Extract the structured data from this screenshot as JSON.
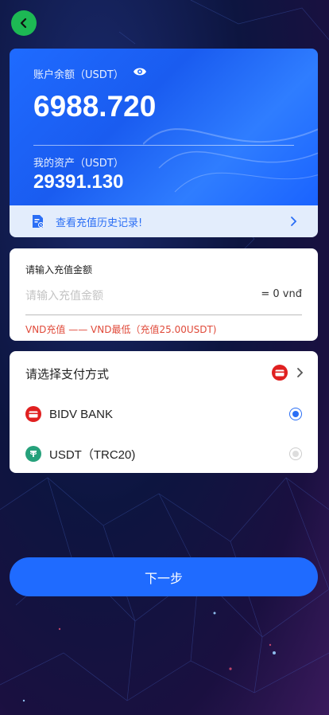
{
  "balance": {
    "label": "账户余额（USDT）",
    "value": "6988.720",
    "assets_label": "我的资产（USDT）",
    "assets_value": "29391.130"
  },
  "history": {
    "label": "查看充值历史记录!"
  },
  "amount": {
    "title": "请输入充值金额",
    "placeholder": "请输入充值金额",
    "conversion": "= 0 vnđ",
    "note": "VND充值 —— VND最低（充值25.00USDT)"
  },
  "payment": {
    "header": "请选择支付方式",
    "options": [
      {
        "label": "BIDV BANK",
        "icon": "card-icon",
        "selected": true
      },
      {
        "label": "USDT（TRC20)",
        "icon": "tether-icon",
        "selected": false
      }
    ]
  },
  "next_button": {
    "label": "下一步"
  },
  "colors": {
    "accent": "#1f6bff",
    "back": "#1db954",
    "note": "#e04a3a"
  }
}
